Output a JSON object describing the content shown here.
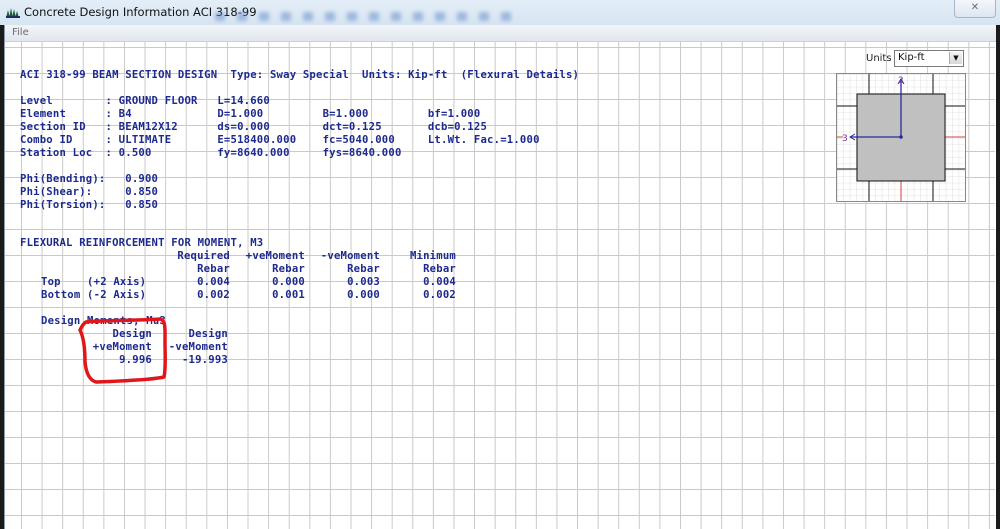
{
  "window": {
    "title": "Concrete Design Information  ACI 318-99",
    "close_label": "✕",
    "menu": [
      "File"
    ]
  },
  "units": {
    "label": "Units",
    "selected": "Kip-ft"
  },
  "report": {
    "header": "ACI 318-99 BEAM SECTION DESIGN  Type: Sway Special  Units: Kip-ft  (Flexural Details)",
    "info_lines": [
      "Level        : GROUND FLOOR   L=14.660",
      "Element      : B4             D=1.000         B=1.000         bf=1.000",
      "Section ID   : BEAM12X12      ds=0.000        dct=0.125       dcb=0.125",
      "Combo ID     : ULTIMATE       E=518400.000    fc=5040.000     Lt.Wt. Fac.=1.000",
      "Station Loc  : 0.500          fy=8640.000     fys=8640.000"
    ],
    "phi_lines": [
      "Phi(Bending):   0.900",
      "Phi(Shear):     0.850",
      "Phi(Torsion):   0.850"
    ],
    "flexural_title": "FLEXURAL REINFORCEMENT FOR MOMENT, M3",
    "flexural_table": {
      "headers_row1": [
        "",
        "Required",
        "+veMoment",
        "-veMoment",
        "Minimum"
      ],
      "headers_row2": [
        "",
        "Rebar",
        "Rebar",
        "Rebar",
        "Rebar"
      ],
      "rows": [
        {
          "label": "Top    (+2 Axis)",
          "required": "0.004",
          "pos": "0.000",
          "neg": "0.003",
          "min": "0.004"
        },
        {
          "label": "Bottom (-2 Axis)",
          "required": "0.002",
          "pos": "0.001",
          "neg": "0.000",
          "min": "0.002"
        }
      ]
    },
    "moments_title": "Design Moments, Mu3",
    "moments": {
      "header1": [
        "Design",
        "Design"
      ],
      "header2": [
        "+veMoment",
        "-veMoment"
      ],
      "values": [
        "9.996",
        "-19.993"
      ]
    }
  },
  "section_view": {
    "axis_2": "2",
    "axis_3": "3"
  },
  "colors": {
    "text": "#1d2a8c",
    "annotation": "#e0161b",
    "section_fill": "#c0c0c0",
    "axis": "#2a2aa0"
  }
}
